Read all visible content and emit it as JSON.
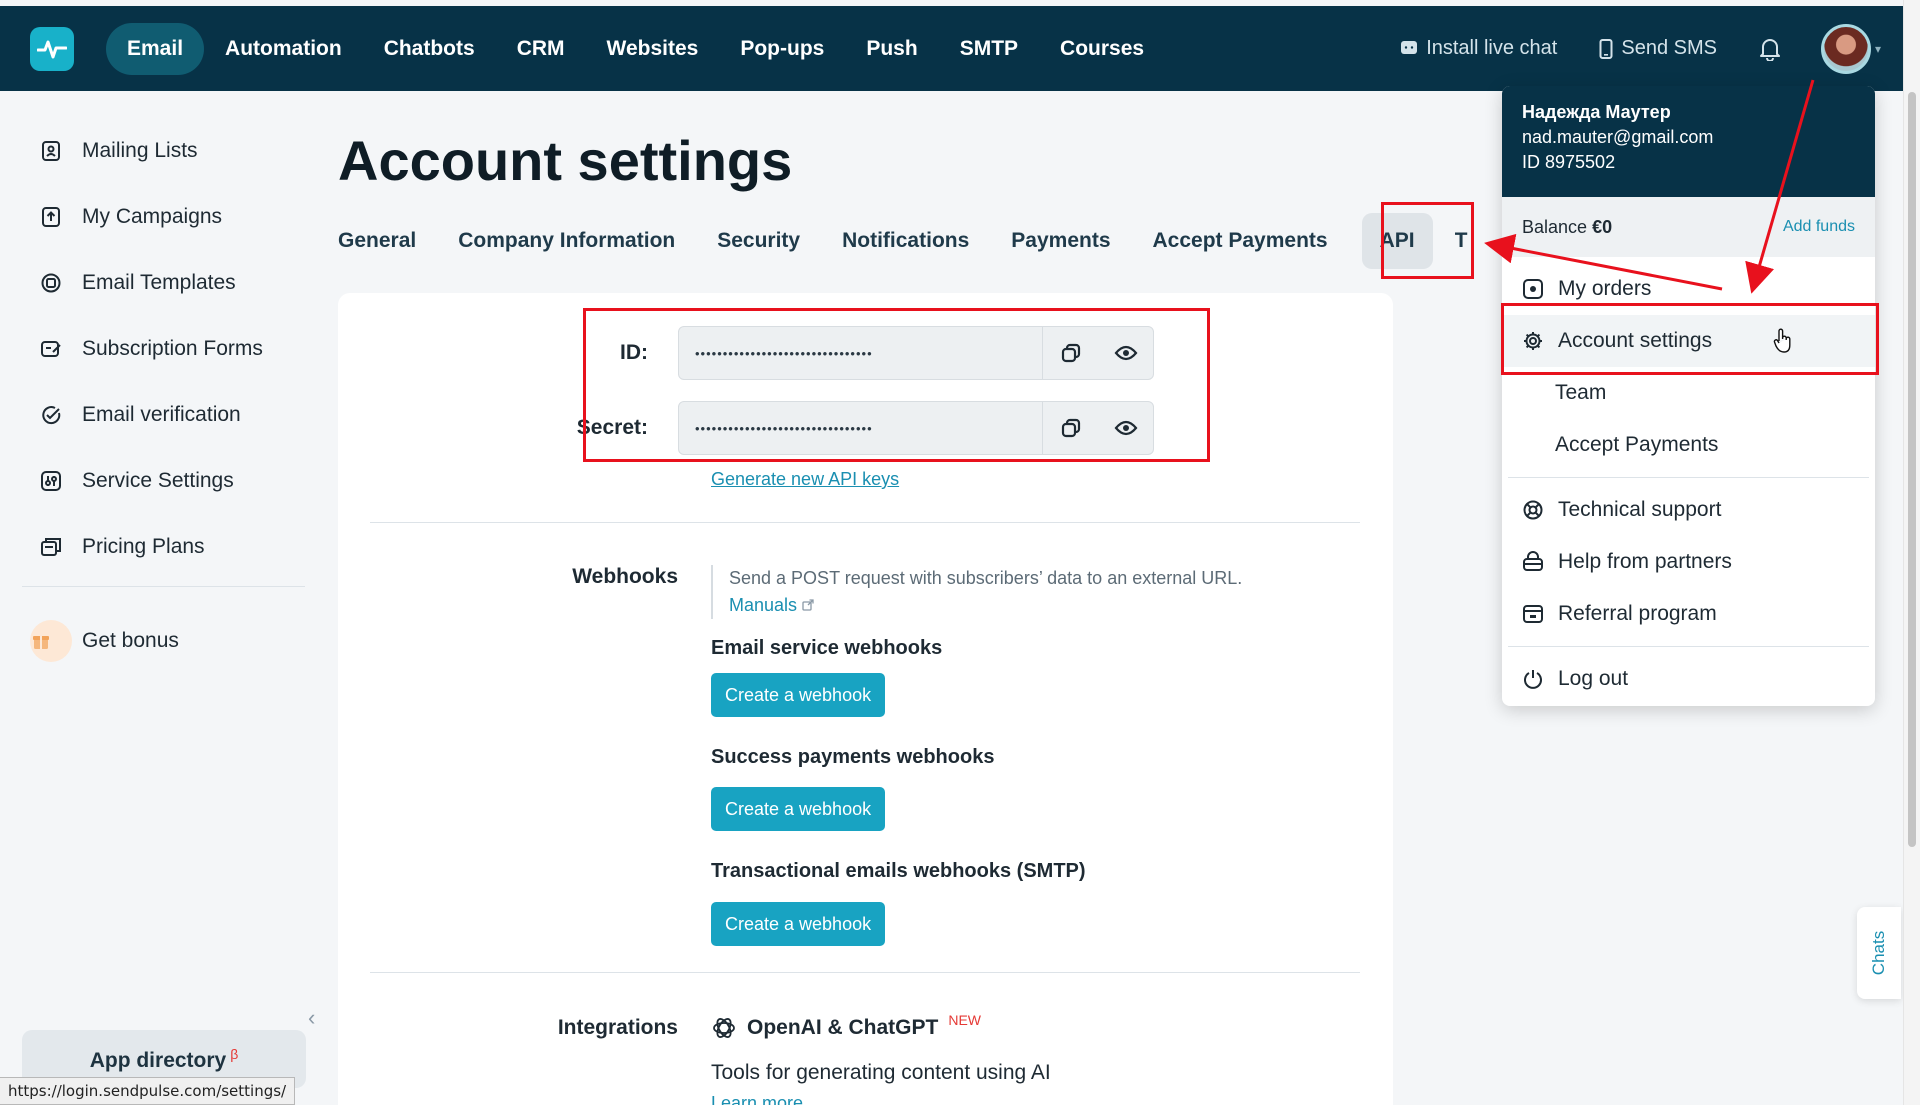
{
  "topnav": {
    "items": [
      "Email",
      "Automation",
      "Chatbots",
      "CRM",
      "Websites",
      "Pop-ups",
      "Push",
      "SMTP",
      "Courses"
    ],
    "active": "Email",
    "install_live_chat": "Install live chat",
    "send_sms": "Send SMS"
  },
  "sidebar": {
    "items": [
      {
        "label": "Mailing Lists",
        "icon": "contacts-icon"
      },
      {
        "label": "My Campaigns",
        "icon": "upload-icon"
      },
      {
        "label": "Email Templates",
        "icon": "template-icon"
      },
      {
        "label": "Subscription Forms",
        "icon": "form-icon"
      },
      {
        "label": "Email verification",
        "icon": "verify-icon"
      },
      {
        "label": "Service Settings",
        "icon": "settings-sliders-icon"
      },
      {
        "label": "Pricing Plans",
        "icon": "pricing-icon"
      }
    ],
    "bonus": "Get bonus",
    "app_directory": "App directory",
    "app_directory_badge": "β"
  },
  "status_url": "https://login.sendpulse.com/settings/",
  "page": {
    "title": "Account settings",
    "tabs": [
      "General",
      "Company Information",
      "Security",
      "Notifications",
      "Payments",
      "Accept Payments",
      "API",
      "T"
    ],
    "active_tab": "API"
  },
  "api": {
    "id_label": "ID:",
    "id_value": "••••••••••••••••••••••••••••••••",
    "secret_label": "Secret:",
    "secret_value": "••••••••••••••••••••••••••••••••",
    "generate_link": "Generate new API keys"
  },
  "webhooks": {
    "label": "Webhooks",
    "note": "Send a POST request with subscribers’ data to an external URL.",
    "manuals": "Manuals",
    "groups": [
      {
        "title": "Email service webhooks",
        "button": "Create a webhook"
      },
      {
        "title": "Success payments webhooks",
        "button": "Create a webhook"
      },
      {
        "title": "Transactional emails webhooks (SMTP)",
        "button": "Create a webhook"
      }
    ]
  },
  "integrations": {
    "label": "Integrations",
    "name": "OpenAI & ChatGPT",
    "badge": "NEW",
    "desc": "Tools for generating content using AI",
    "learn_more": "Learn more"
  },
  "menu": {
    "name": "Надежда Маутер",
    "email": "nad.mauter@gmail.com",
    "id": "ID 8975502",
    "balance_label": "Balance",
    "balance_value": "€0",
    "add_funds": "Add funds",
    "items": [
      "My orders",
      "Account settings",
      "Team",
      "Accept Payments",
      "Technical support",
      "Help from partners",
      "Referral program",
      "Log out"
    ]
  },
  "chats_tab": "Chats",
  "colors": {
    "nav_bg": "#073247",
    "accent": "#18a3c2",
    "annotation": "#e8111d"
  }
}
